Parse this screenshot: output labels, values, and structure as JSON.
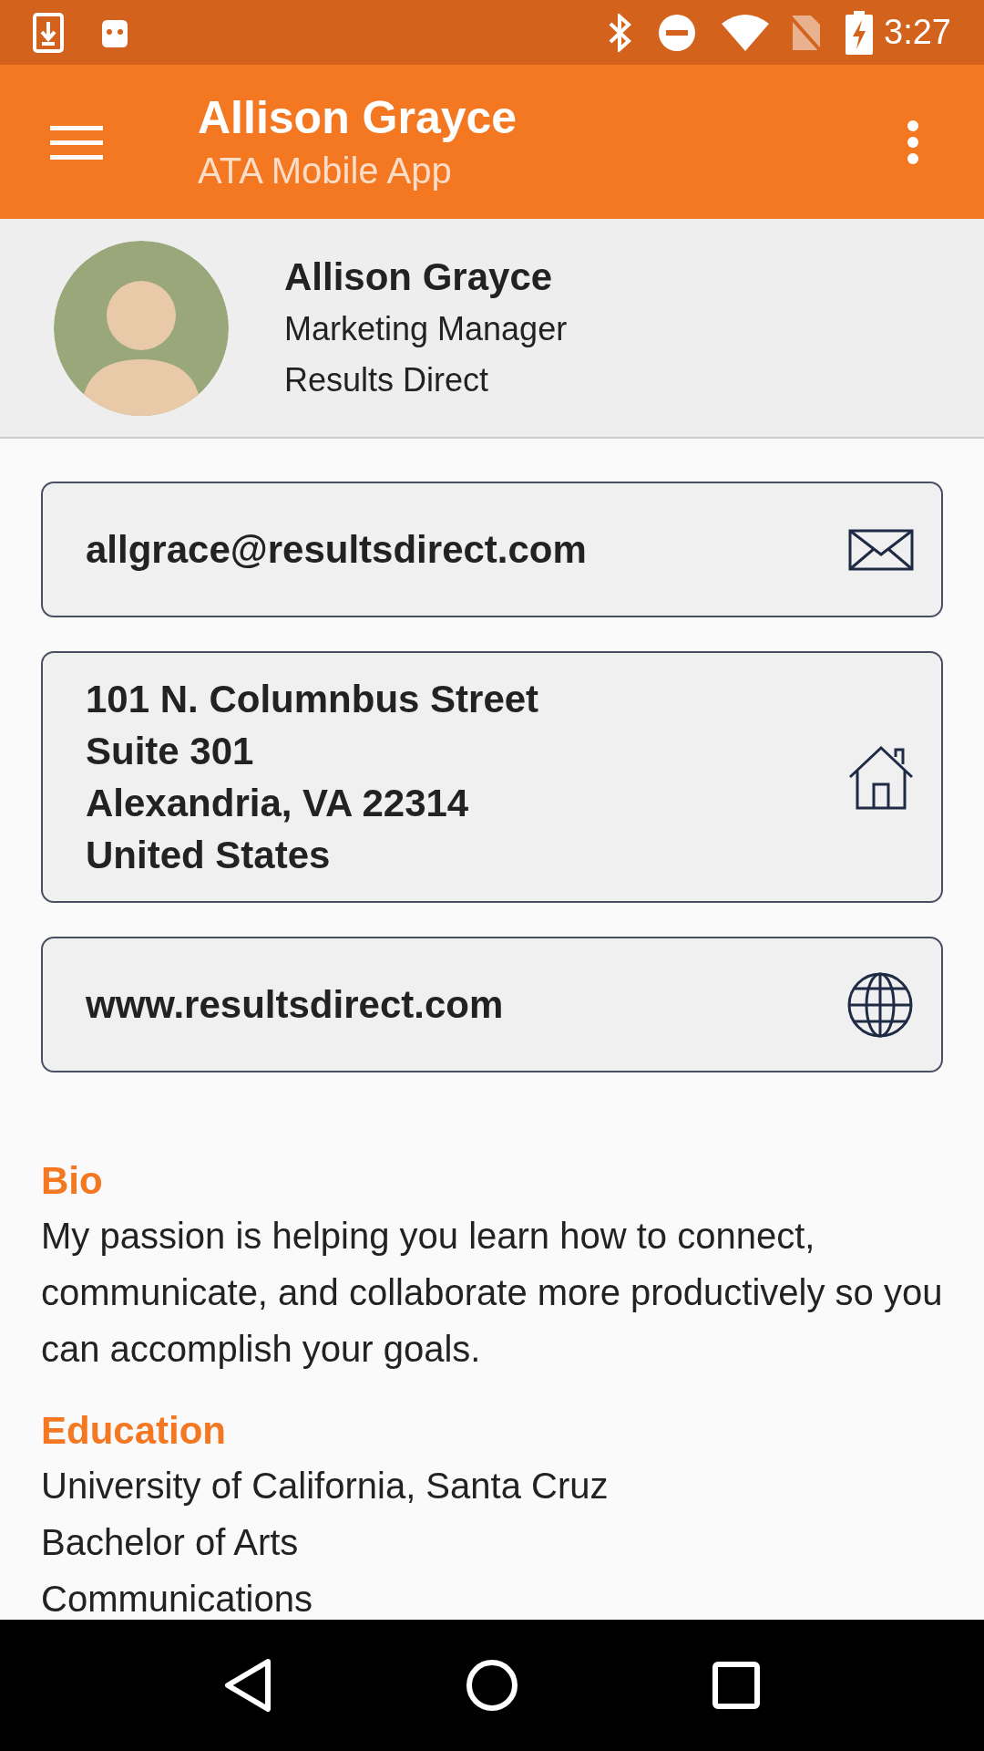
{
  "status_bar": {
    "time": "3:27"
  },
  "app_bar": {
    "title": "Allison Grayce",
    "subtitle": "ATA Mobile App"
  },
  "profile": {
    "name": "Allison Grayce",
    "job_title": "Marketing Manager",
    "company": "Results Direct"
  },
  "contact_cards": [
    {
      "kind": "email",
      "lines": [
        "allgrace@resultsdirect.com"
      ]
    },
    {
      "kind": "address",
      "lines": [
        "101 N. Columnbus Street",
        "Suite 301",
        "Alexandria, VA 22314",
        "United States"
      ]
    },
    {
      "kind": "website",
      "lines": [
        "www.resultsdirect.com"
      ]
    }
  ],
  "sections": [
    {
      "heading": "Bio",
      "lines": [
        "My passion is helping you learn how to connect, communicate, and collaborate more productively so you can accomplish your goals."
      ]
    },
    {
      "heading": "Education",
      "lines": [
        "University of California, Santa Cruz",
        "Bachelor of Arts",
        "Communications"
      ]
    }
  ]
}
